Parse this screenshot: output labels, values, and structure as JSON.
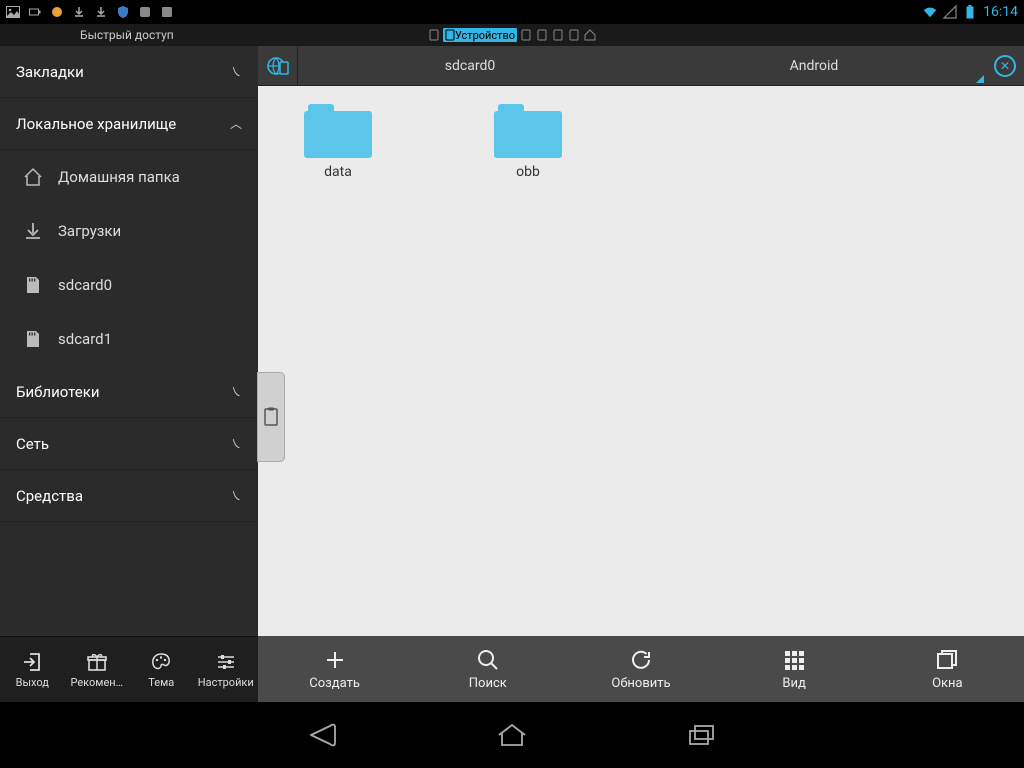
{
  "status_bar": {
    "time": "16:14"
  },
  "app_header": {
    "quick_access": "Быстрый доступ",
    "active_device": "Устройство"
  },
  "sidebar": {
    "sections": {
      "bookmarks": "Закладки",
      "local_storage": "Локальное хранилище",
      "libraries": "Библиотеки",
      "network": "Сеть",
      "tools": "Средства"
    },
    "local_items": {
      "home": "Домашняя папка",
      "downloads": "Загрузки",
      "sdcard0": "sdcard0",
      "sdcard1": "sdcard1"
    },
    "bottom_buttons": {
      "exit": "Выход",
      "recommend": "Рекомен…",
      "theme": "Тема",
      "settings": "Настройки"
    }
  },
  "path_bar": {
    "seg1": "sdcard0",
    "seg2": "Android"
  },
  "folders": [
    {
      "name": "data"
    },
    {
      "name": "obb"
    }
  ],
  "content_toolbar": {
    "create": "Создать",
    "search": "Поиск",
    "refresh": "Обновить",
    "view": "Вид",
    "windows": "Окна"
  }
}
